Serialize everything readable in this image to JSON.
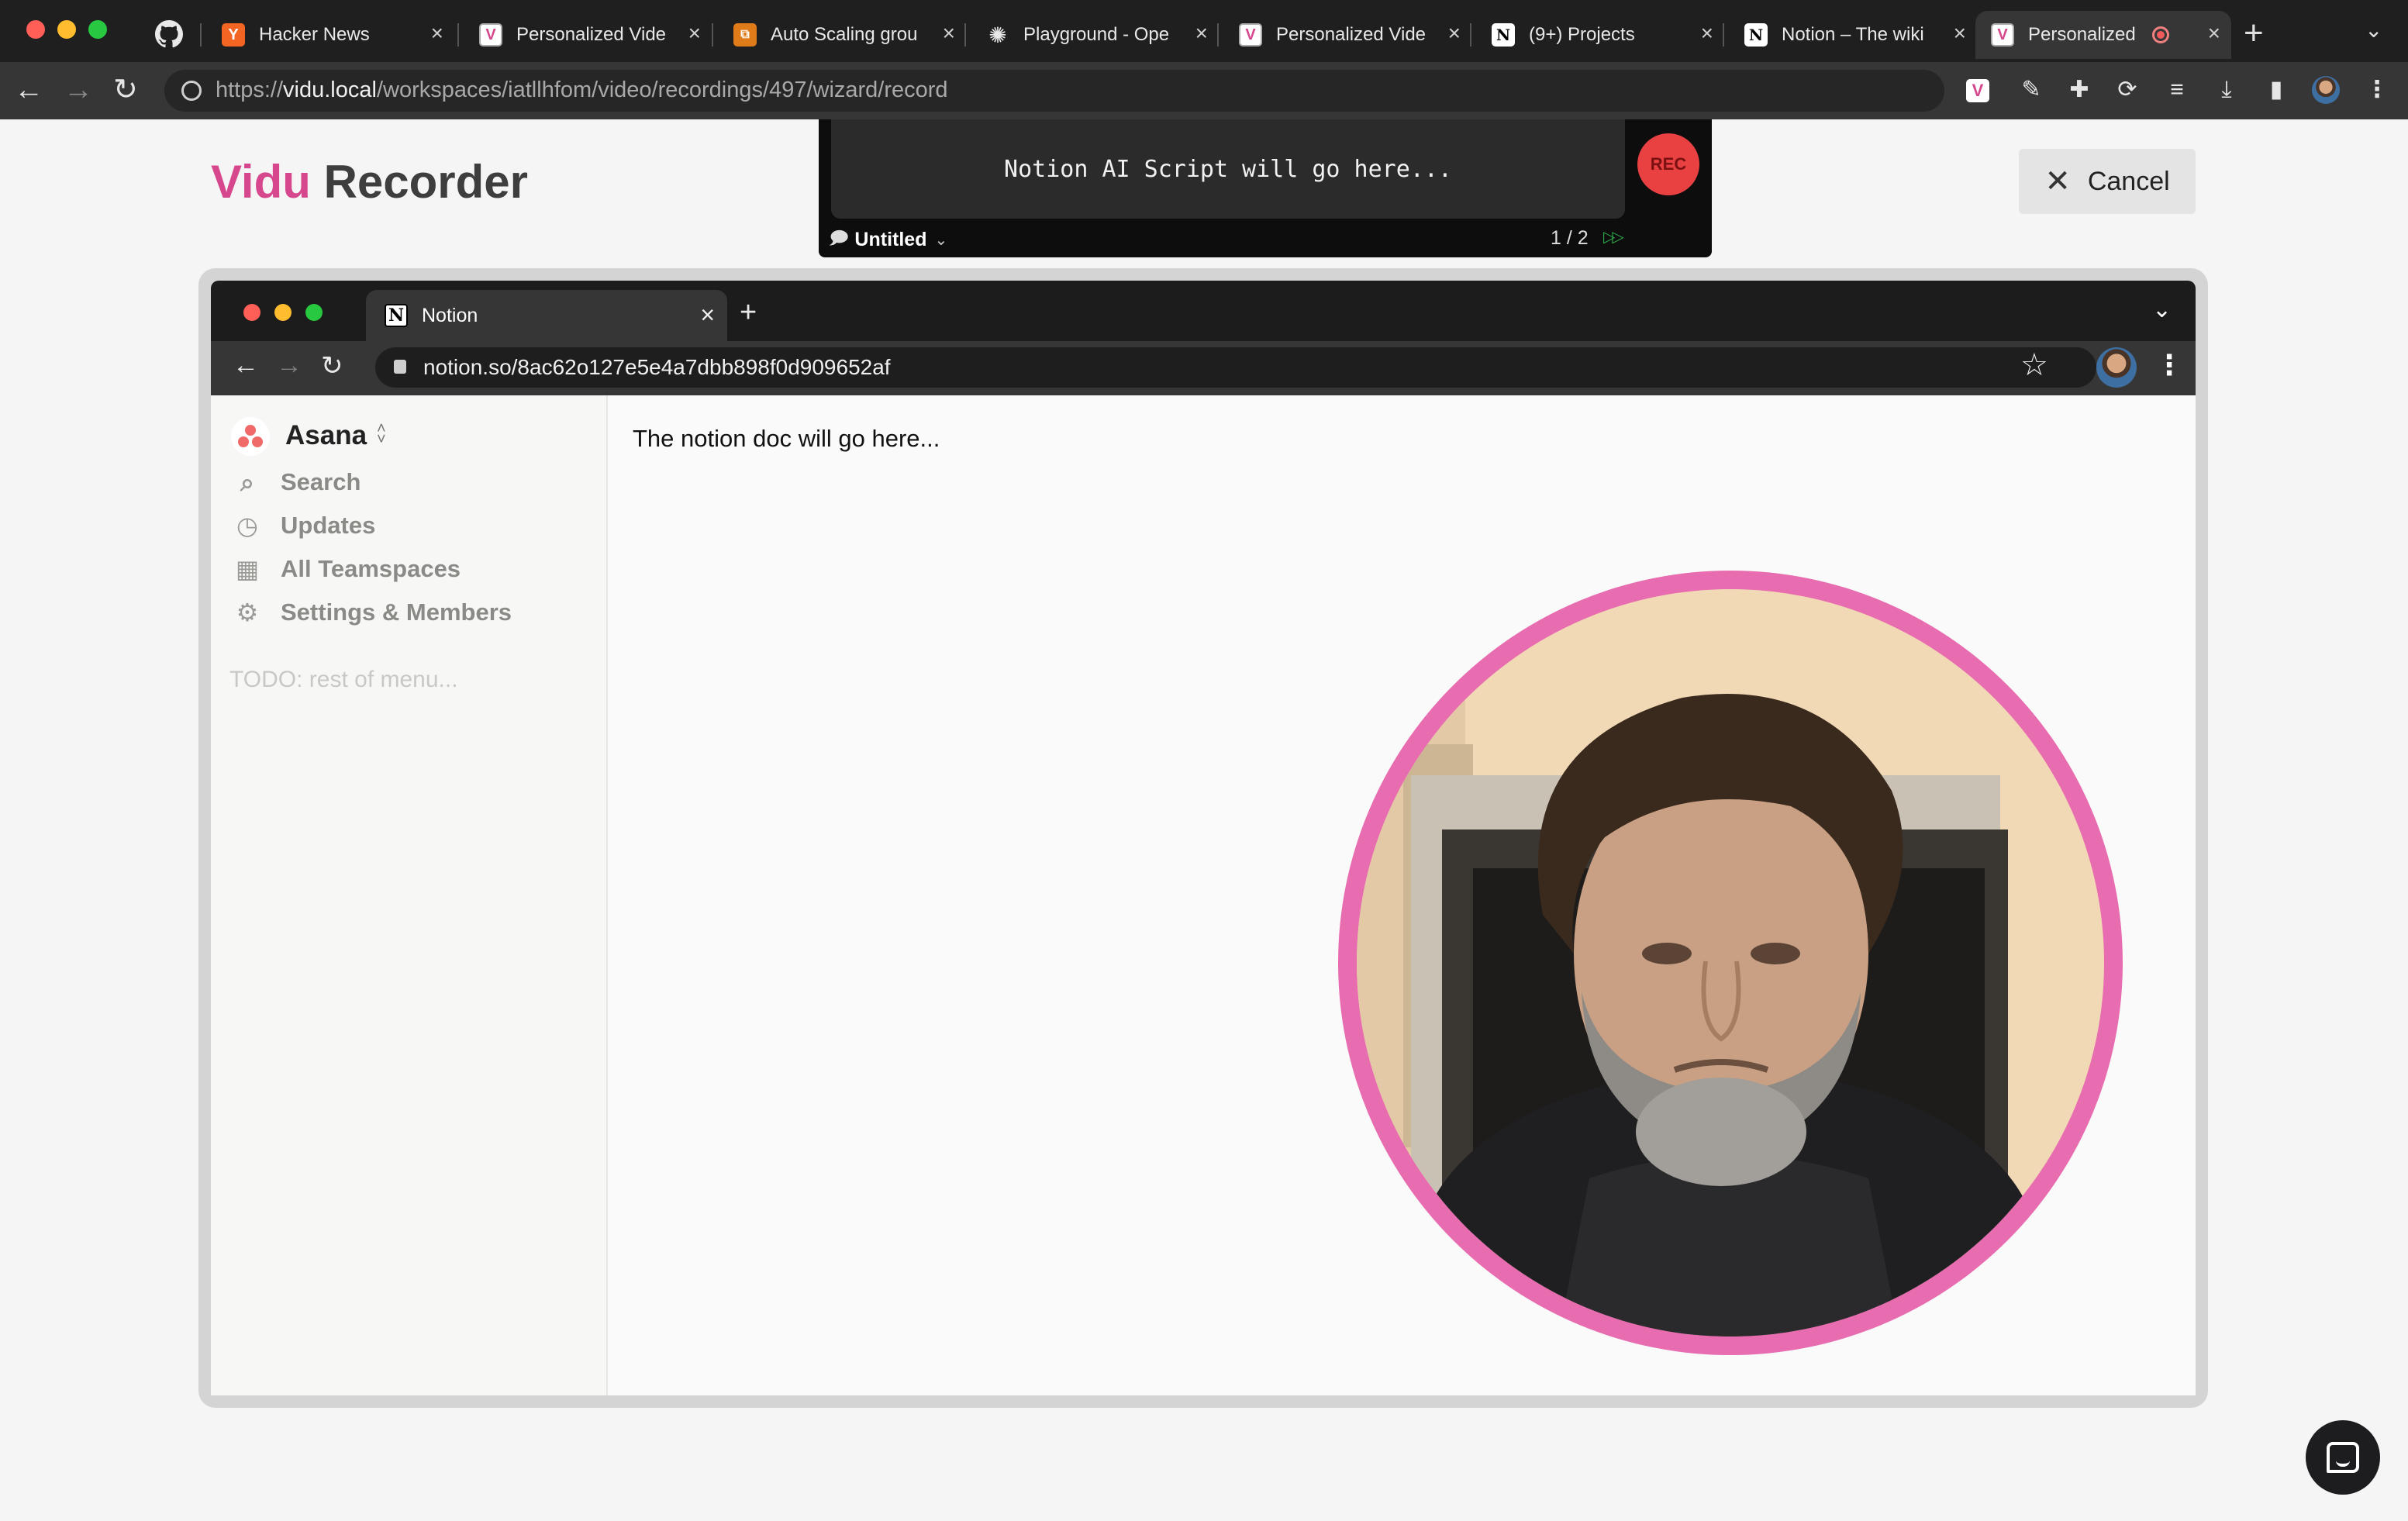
{
  "browser": {
    "tabs": [
      {
        "label": "",
        "favicon": "github-icon"
      },
      {
        "label": "Hacker News",
        "favicon": "Y",
        "favicon_bg": "#f26522"
      },
      {
        "label": "Personalized Vide",
        "favicon": "V",
        "favicon_bg": "#ffffff"
      },
      {
        "label": "Auto Scaling grou",
        "favicon": "aws-icon",
        "favicon_bg": "#e07b1a"
      },
      {
        "label": "Playground - Ope",
        "favicon": "openai-icon"
      },
      {
        "label": "Personalized Vide",
        "favicon": "V",
        "favicon_bg": "#ffffff"
      },
      {
        "label": "(9+) Projects",
        "favicon": "N"
      },
      {
        "label": "Notion – The wiki",
        "favicon": "N"
      },
      {
        "label": "Personalized",
        "favicon": "V",
        "favicon_bg": "#ffffff",
        "recording": true
      }
    ],
    "url_prefix": "https://",
    "url_host": "vidu.local",
    "url_path": "/workspaces/iatllhfom/video/recordings/497/wizard/record"
  },
  "app": {
    "brand": "Vidu",
    "title_rest": "Recorder",
    "cancel_label": "Cancel",
    "brand_color": "#d6478d"
  },
  "script_panel": {
    "script_text": "Notion AI Script will go here...",
    "rec_label": "REC",
    "script_name": "Untitled",
    "page_indicator": "1 / 2"
  },
  "inner_browser": {
    "tab_label": "Notion",
    "url": "notion.so/8ac62o127e5e4a7dbb898f0d909652af"
  },
  "notion": {
    "workspace": "Asana",
    "nav": [
      {
        "label": "Search",
        "icon": "search-icon"
      },
      {
        "label": "Updates",
        "icon": "clock-icon"
      },
      {
        "label": "All Teamspaces",
        "icon": "building-icon"
      },
      {
        "label": "Settings & Members",
        "icon": "gear-icon"
      }
    ],
    "todo": "TODO: rest of menu...",
    "doc_text": "The notion doc will go here..."
  },
  "camera": {
    "ring_color": "#e86cb0"
  },
  "chat": {
    "icon": "chat-icon"
  }
}
